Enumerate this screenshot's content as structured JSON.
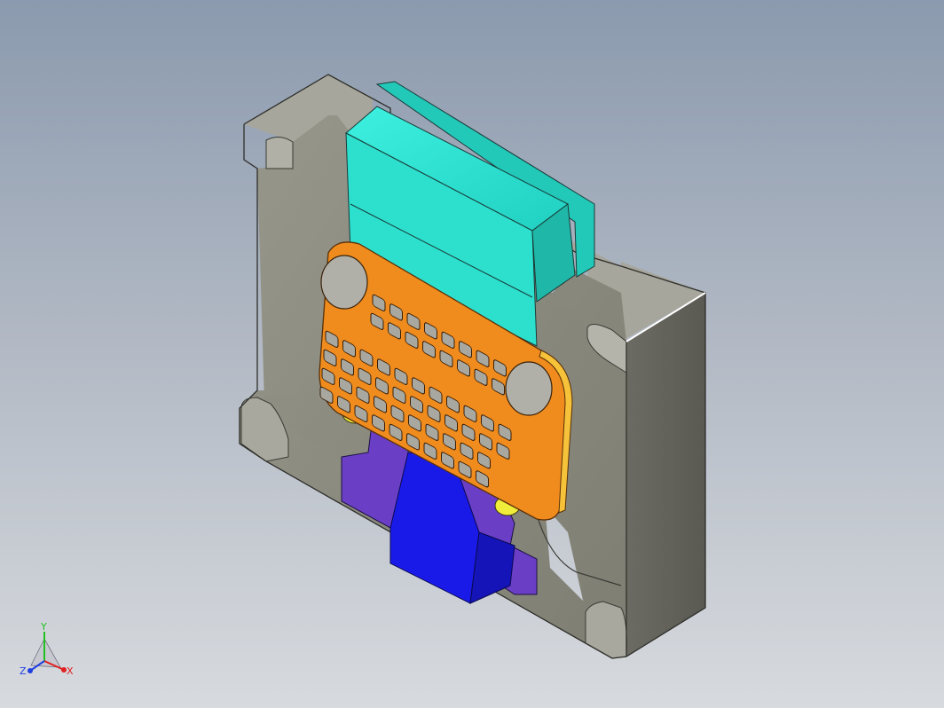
{
  "viewport": {
    "background_top": "#8b9aae",
    "background_bottom": "#d7dade"
  },
  "model": {
    "parts": [
      {
        "name": "mold-base-plate",
        "color": "#8a8a7e"
      },
      {
        "name": "cavity-insert",
        "color": "#35e6d6"
      },
      {
        "name": "keypad-part",
        "color": "#f08c1e"
      },
      {
        "name": "slider-block",
        "color": "#6a3fc6"
      },
      {
        "name": "wedge-block",
        "color": "#1a1ae8"
      },
      {
        "name": "guide-pins",
        "color": "#f0ec3a"
      }
    ]
  },
  "triad": {
    "x_label": "X",
    "y_label": "Y",
    "z_label": "Z",
    "x_color": "#e02020",
    "y_color": "#20c020",
    "z_color": "#2040e0"
  }
}
